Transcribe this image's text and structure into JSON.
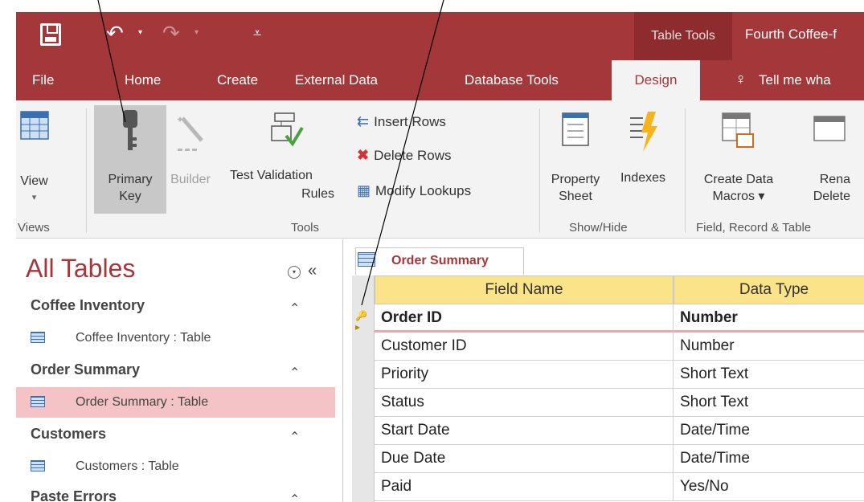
{
  "window": {
    "context_tab": "Table Tools",
    "title": "Fourth Coffee-f"
  },
  "tabs": [
    {
      "label": "File"
    },
    {
      "label": "Home"
    },
    {
      "label": "Create"
    },
    {
      "label": "External Data"
    },
    {
      "label": "Database Tools"
    },
    {
      "label": "Design"
    },
    {
      "label": "Tell me wha"
    }
  ],
  "ribbon": {
    "view": {
      "label": "View",
      "dd": "▾"
    },
    "primary_key": {
      "line1": "Primary",
      "line2": "Key"
    },
    "builder": {
      "label": "Builder"
    },
    "test_validation": {
      "line1": "Test Validation",
      "line2": "Rules"
    },
    "insert_rows": "Insert Rows",
    "delete_rows": "Delete Rows",
    "modify_lookups": "Modify Lookups",
    "property_sheet": {
      "line1": "Property",
      "line2": "Sheet"
    },
    "indexes": "Indexes",
    "create_data_macros": {
      "line1": "Create Data",
      "line2": "Macros ▾"
    },
    "rename_delete": {
      "line1": "Rena",
      "line2": "Delete"
    },
    "groups": {
      "views": "Views",
      "tools": "Tools",
      "show_hide": "Show/Hide",
      "field_record_table": "Field, Record & Table"
    }
  },
  "nav": {
    "title": "All Tables",
    "collapse": "«",
    "groups": [
      {
        "name": "Coffee Inventory",
        "item": "Coffee Inventory : Table",
        "selected": false
      },
      {
        "name": "Order Summary",
        "item": "Order Summary : Table",
        "selected": true
      },
      {
        "name": "Customers",
        "item": "Customers : Table",
        "selected": false
      },
      {
        "name": "Paste Errors",
        "item": "",
        "selected": false
      }
    ]
  },
  "document": {
    "tab_label": "Order Summary",
    "columns": [
      "Field Name",
      "Data Type"
    ],
    "rows": [
      [
        "Order ID",
        "Number"
      ],
      [
        "Customer ID",
        "Number"
      ],
      [
        "Priority",
        "Short Text"
      ],
      [
        "Status",
        "Short Text"
      ],
      [
        "Start Date",
        "Date/Time"
      ],
      [
        "Due Date",
        "Date/Time"
      ],
      [
        "Paid",
        "Yes/No"
      ]
    ]
  },
  "colors": {
    "accent": "#a4373a",
    "header_fill": "#fbe38a",
    "selected_nav": "#f4c3c5"
  }
}
